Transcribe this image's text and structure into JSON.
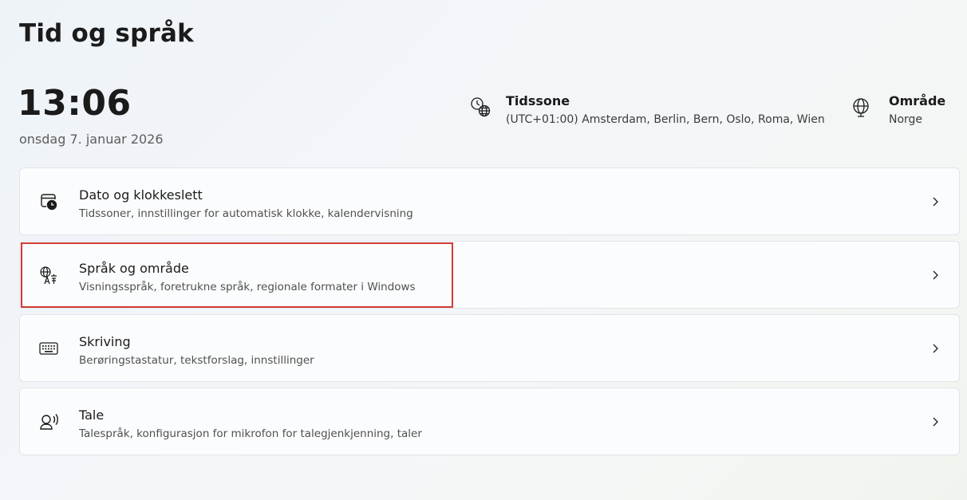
{
  "header": {
    "title": "Tid og språk"
  },
  "clock": {
    "time": "13:06",
    "date": "onsdag 7. januar 2026"
  },
  "timezone": {
    "icon": "clock-globe-icon",
    "title": "Tidssone",
    "value": "(UTC+01:00) Amsterdam, Berlin, Bern, Oslo, Roma, Wien"
  },
  "region": {
    "icon": "globe-icon",
    "title": "Område",
    "value": "Norge"
  },
  "cards": [
    {
      "icon": "calendar-clock-icon",
      "title": "Dato og klokkeslett",
      "subtitle": "Tidssoner, innstillinger for automatisk klokke, kalendervisning"
    },
    {
      "icon": "language-icon",
      "title": "Språk og område",
      "subtitle": "Visningsspråk, foretrukne språk, regionale formater i Windows"
    },
    {
      "icon": "keyboard-icon",
      "title": "Skriving",
      "subtitle": "Berøringstastatur, tekstforslag, innstillinger"
    },
    {
      "icon": "speech-icon",
      "title": "Tale",
      "subtitle": "Talespråk, konfigurasjon for mikrofon for talegjenkjenning, taler"
    }
  ],
  "colors": {
    "highlight": "#d13b34",
    "card_bg": "#fbfcfd",
    "card_border": "#e1e5e9"
  }
}
